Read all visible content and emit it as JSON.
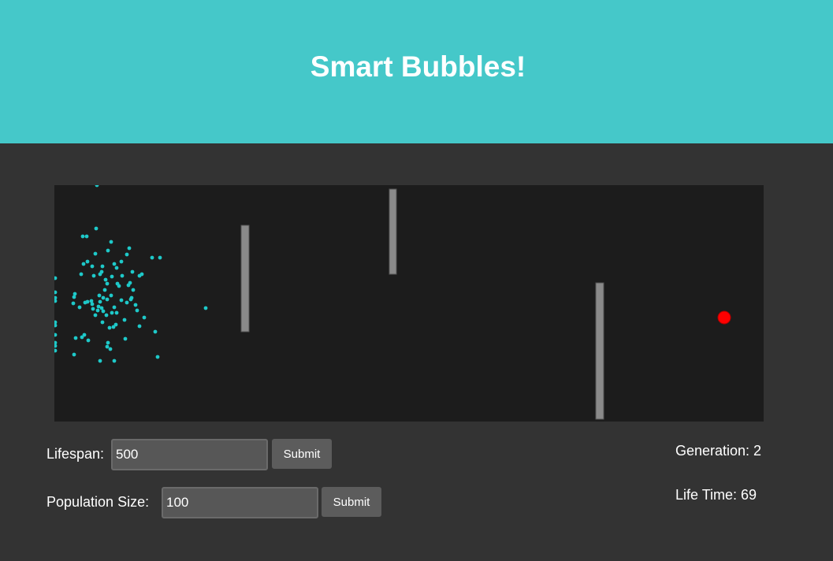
{
  "header": {
    "title": "Smart Bubbles!",
    "background": "#45c8c9"
  },
  "simulation": {
    "target_color": "#ff0000",
    "bubble_color": "#1ec9c9",
    "obstacle_color": "#8a8a8a",
    "background": "#1c1c1c"
  },
  "controls": {
    "lifespan_label": "Lifespan:",
    "lifespan_value": "500",
    "lifespan_submit": "Submit",
    "population_label": "Population Size:",
    "population_value": "100",
    "population_submit": "Submit"
  },
  "stats": {
    "generation_text": "Generation: 2",
    "lifetime_text": "Life Time: 69"
  }
}
